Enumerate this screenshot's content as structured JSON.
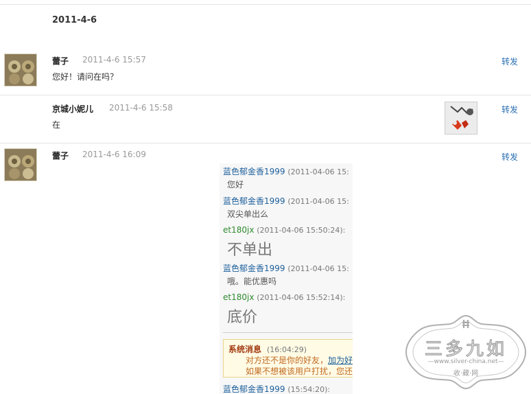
{
  "date_header": "2011-4-6",
  "forward_label": "转发",
  "messages": [
    {
      "sender": "蕾子",
      "time": "2011-4-6 15:57",
      "text": "您好！请问在吗？"
    },
    {
      "sender": "京城小妮儿",
      "time": "2011-4-6 15:58",
      "text": "在"
    },
    {
      "sender": "蕾子",
      "time": "2011-4-6 16:09",
      "text": ""
    }
  ],
  "chat": {
    "entries": [
      {
        "name": "蓝色郁金香1999",
        "ts": "(2011-04-06 15:",
        "body": "您好"
      },
      {
        "name": "蓝色郁金香1999",
        "ts": "(2011-04-06 15:",
        "body": "双尖单出么"
      },
      {
        "name": "et180jx",
        "ts": "(2011-04-06 15:50:24):",
        "body": "不单出"
      },
      {
        "name": "蓝色郁金香1999",
        "ts": "(2011-04-06 15:",
        "body": "哦。能优惠吗"
      },
      {
        "name": "et180jx",
        "ts": "(2011-04-06 15:52:14):",
        "body": "底价"
      }
    ],
    "system": {
      "title": "系统消息",
      "time": "(16:04:29)",
      "line1_prefix": "对方还不是你的好友，",
      "line1_link": "加为好",
      "line2": "如果不想被该用户打扰，您还"
    },
    "last_entry": {
      "name": "蓝色郁金香1999",
      "ts": "(15:54:20):"
    }
  },
  "watermark": {
    "title": "三多九如",
    "url": "www.silver-china.net",
    "sub": "收·藏·网"
  },
  "colors": {
    "link_blue": "#2a6fb0",
    "sender_blue": "#1c5f9c",
    "sender_green": "#2f8a2f",
    "system_title": "#a33c12",
    "system_text": "#c06a20"
  }
}
